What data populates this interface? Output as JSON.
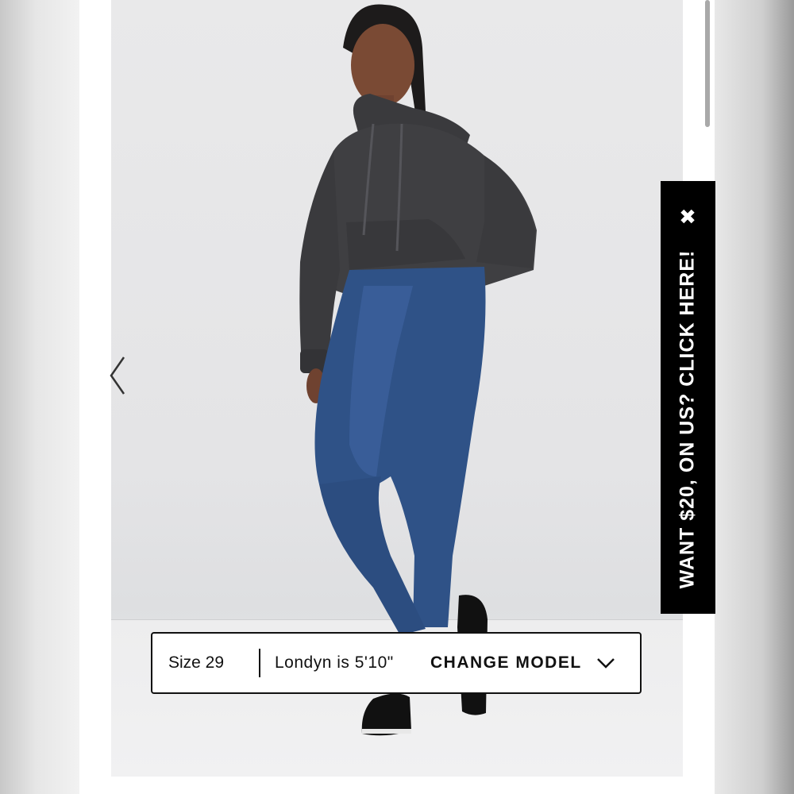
{
  "promo": {
    "text": "WANT $20, ON US? CLICK HERE!",
    "close_symbol": "✖",
    "background": "#000000",
    "text_color": "#ffffff"
  },
  "model_bar": {
    "size": "Size 29",
    "model": "Londyn is 5'10\"",
    "change_model": "CHANGE MODEL",
    "chevron_icon": "chevron-down-icon"
  },
  "gallery": {
    "prev_icon": "chevron-left-icon",
    "colors": {
      "hoodie": "#3f3f42",
      "jeans": "#2f5287",
      "background": "#e6e6e8"
    }
  }
}
